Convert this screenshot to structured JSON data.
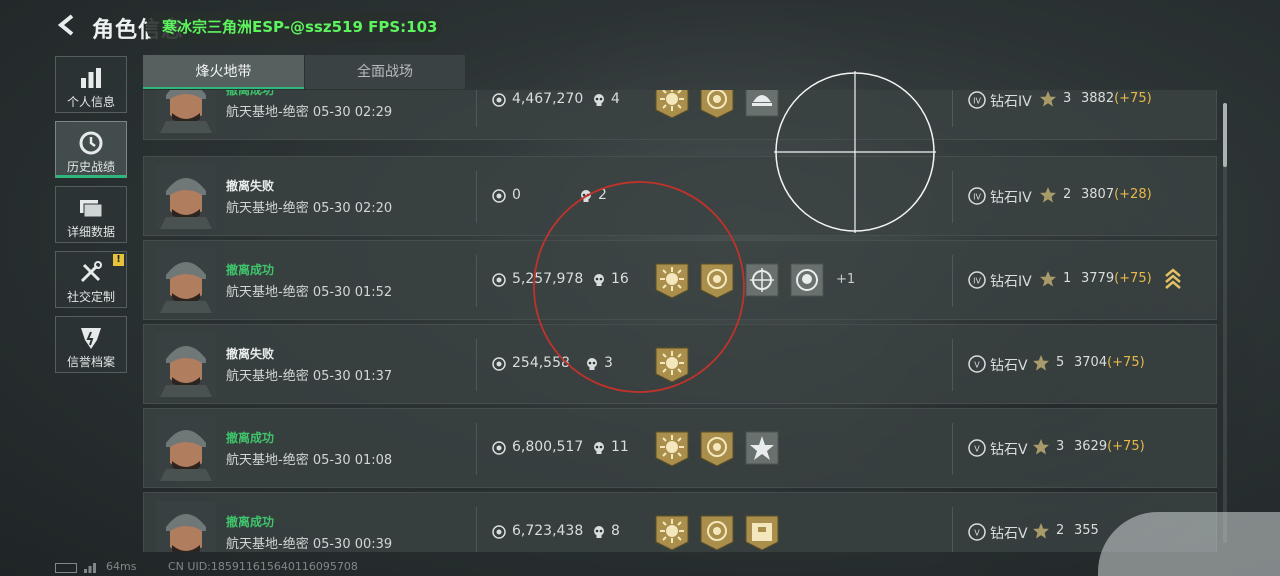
{
  "header": {
    "title": "角色信息",
    "overlay_text": "寒冰宗三角洲ESP-@ssz519 FPS:103"
  },
  "tabs": [
    {
      "label": "烽火地带",
      "active": true
    },
    {
      "label": "全面战场",
      "active": false
    }
  ],
  "sidebar": {
    "items": [
      {
        "label": "个人信息",
        "icon": "bar-chart-icon",
        "active": false
      },
      {
        "label": "历史战绩",
        "icon": "clock-icon",
        "active": true
      },
      {
        "label": "详细数据",
        "icon": "cards-icon",
        "active": false
      },
      {
        "label": "社交定制",
        "icon": "tools-icon",
        "active": false,
        "badge": "!"
      },
      {
        "label": "信誉档案",
        "icon": "emblem-icon",
        "active": false
      }
    ]
  },
  "matches": [
    {
      "status": "撤离成功",
      "map": "航天基地-绝密 05-30 02:29",
      "money": "4,467,270",
      "kills": "4",
      "extra": "",
      "rank": "钻石IV",
      "stars": "3",
      "score": "3882",
      "delta": "(+75)"
    },
    {
      "status": "撤离失败",
      "map": "航天基地-绝密 05-30 02:20",
      "money": "0",
      "kills": "2",
      "extra": "",
      "rank": "钻石IV",
      "stars": "2",
      "score": "3807",
      "delta": "(+28)"
    },
    {
      "status": "撤离成功",
      "map": "航天基地-绝密 05-30 01:52",
      "money": "5,257,978",
      "kills": "16",
      "extra": "+1",
      "rank": "钻石IV",
      "stars": "1",
      "score": "3779",
      "delta": "(+75)"
    },
    {
      "status": "撤离失败",
      "map": "航天基地-绝密 05-30 01:37",
      "money": "254,558",
      "kills": "3",
      "extra": "",
      "rank": "钻石V",
      "stars": "5",
      "score": "3704",
      "delta": "(+75)"
    },
    {
      "status": "撤离成功",
      "map": "航天基地-绝密 05-30 01:08",
      "money": "6,800,517",
      "kills": "11",
      "extra": "",
      "rank": "钻石V",
      "stars": "3",
      "score": "3629",
      "delta": "(+75)"
    },
    {
      "status": "撤离成功",
      "map": "航天基地-绝密 05-30 00:39",
      "money": "6,723,438",
      "kills": "8",
      "extra": "",
      "rank": "钻石V",
      "stars": "2",
      "score": "355",
      "delta": ""
    }
  ],
  "footer": {
    "ping": "64ms",
    "uid": "CN UID:1859116156401160957​08"
  },
  "colors": {
    "success": "#3fc46b",
    "failure": "#e8ecec",
    "accent": "#2fb67a",
    "delta": "#e7b84a",
    "medal_gold": "#b59a52"
  }
}
